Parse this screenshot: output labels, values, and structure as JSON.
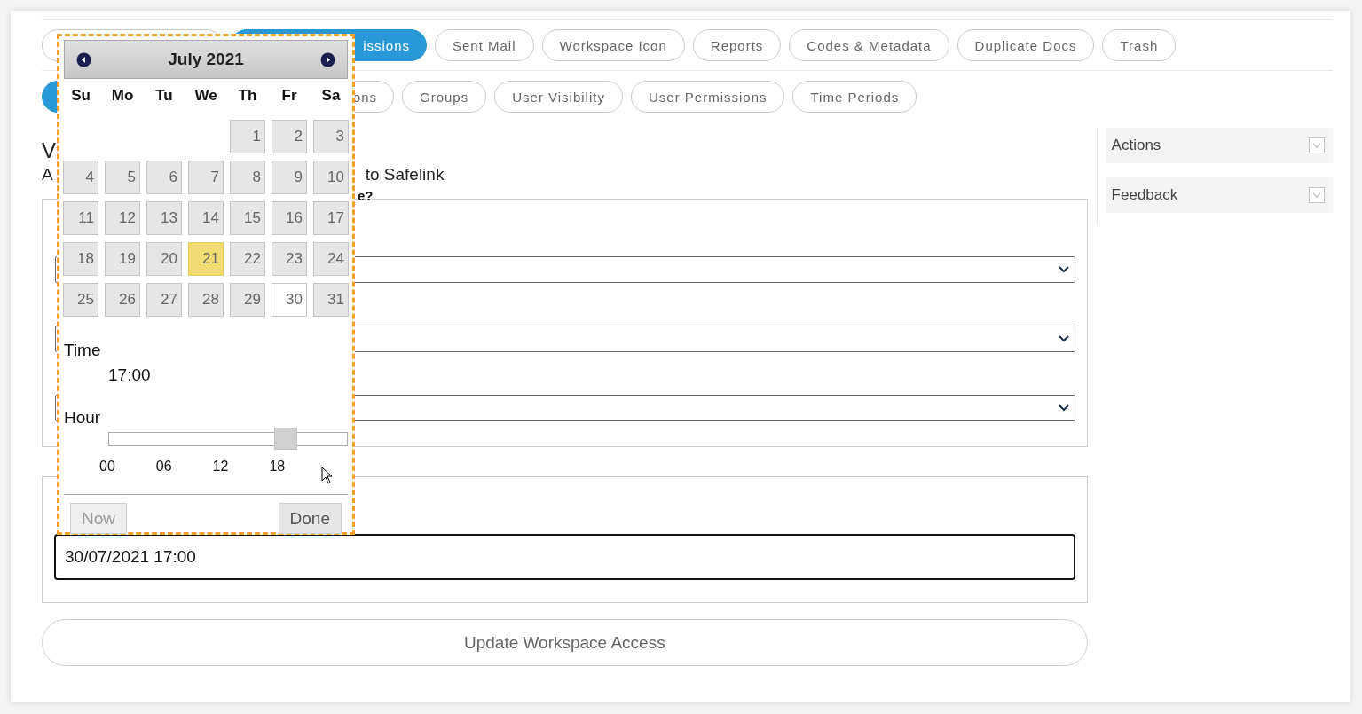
{
  "tab_rows": [
    {
      "tabs": [
        {
          "kind": "hidden",
          "selected": false
        },
        {
          "kind": "partial",
          "label": "issions",
          "selected": true
        },
        {
          "kind": "full",
          "label": "Sent Mail",
          "selected": false
        },
        {
          "kind": "full",
          "label": "Workspace Icon",
          "selected": false
        },
        {
          "kind": "full",
          "label": "Reports",
          "selected": false
        },
        {
          "kind": "full",
          "label": "Codes & Metadata",
          "selected": false
        },
        {
          "kind": "full",
          "label": "Duplicate Docs",
          "selected": false
        },
        {
          "kind": "full",
          "label": "Trash",
          "selected": false
        }
      ]
    },
    {
      "tabs": [
        {
          "kind": "stub",
          "selected": true
        },
        {
          "kind": "partial",
          "label": "ons",
          "selected": false
        },
        {
          "kind": "full",
          "label": "Groups",
          "selected": false
        },
        {
          "kind": "full",
          "label": "User Visibility",
          "selected": false
        },
        {
          "kind": "full",
          "label": "User Permissions",
          "selected": false
        },
        {
          "kind": "full",
          "label": "Time Periods",
          "selected": false
        }
      ]
    }
  ],
  "heading": {
    "visible_part": "V"
  },
  "description": {
    "start": "A",
    "end": "to Safelink"
  },
  "question": {
    "visible_part": "e?"
  },
  "access_panel": {
    "fields": [
      {
        "kind": "select"
      },
      {
        "kind": "select"
      },
      {
        "kind": "select"
      }
    ]
  },
  "date_panel": {
    "value": "30/07/2021 17:00"
  },
  "update_button": "Update Workspace Access",
  "sidebar": {
    "items": [
      {
        "label": "Actions",
        "expanded": false
      },
      {
        "label": "Feedback",
        "expanded": false
      }
    ]
  },
  "datepicker": {
    "month": "July 2021",
    "weekdays": [
      "Su",
      "Mo",
      "Tu",
      "We",
      "Th",
      "Fr",
      "Sa"
    ],
    "weeks": [
      [
        {
          "kind": "blank"
        },
        {
          "kind": "blank"
        },
        {
          "kind": "blank"
        },
        {
          "kind": "blank"
        },
        {
          "day": "1",
          "today": false,
          "selected": false
        },
        {
          "day": "2",
          "today": false,
          "selected": false
        },
        {
          "day": "3",
          "today": false,
          "selected": false
        }
      ],
      [
        {
          "day": "4",
          "today": false,
          "selected": false
        },
        {
          "day": "5",
          "today": false,
          "selected": false
        },
        {
          "day": "6",
          "today": false,
          "selected": false
        },
        {
          "day": "7",
          "today": false,
          "selected": false
        },
        {
          "day": "8",
          "today": false,
          "selected": false
        },
        {
          "day": "9",
          "today": false,
          "selected": false
        },
        {
          "day": "10",
          "today": false,
          "selected": false
        }
      ],
      [
        {
          "day": "11",
          "today": false,
          "selected": false
        },
        {
          "day": "12",
          "today": false,
          "selected": false
        },
        {
          "day": "13",
          "today": false,
          "selected": false
        },
        {
          "day": "14",
          "today": false,
          "selected": false
        },
        {
          "day": "15",
          "today": false,
          "selected": false
        },
        {
          "day": "16",
          "today": false,
          "selected": false
        },
        {
          "day": "17",
          "today": false,
          "selected": false
        }
      ],
      [
        {
          "day": "18",
          "today": false,
          "selected": false
        },
        {
          "day": "19",
          "today": false,
          "selected": false
        },
        {
          "day": "20",
          "today": false,
          "selected": false
        },
        {
          "day": "21",
          "today": true,
          "selected": false
        },
        {
          "day": "22",
          "today": false,
          "selected": false
        },
        {
          "day": "23",
          "today": false,
          "selected": false
        },
        {
          "day": "24",
          "today": false,
          "selected": false
        }
      ],
      [
        {
          "day": "25",
          "today": false,
          "selected": false
        },
        {
          "day": "26",
          "today": false,
          "selected": false
        },
        {
          "day": "27",
          "today": false,
          "selected": false
        },
        {
          "day": "28",
          "today": false,
          "selected": false
        },
        {
          "day": "29",
          "today": false,
          "selected": false
        },
        {
          "day": "30",
          "today": false,
          "selected": true
        },
        {
          "day": "31",
          "today": false,
          "selected": false
        }
      ]
    ],
    "time_label": "Time",
    "time_value": "17:00",
    "hour_label": "Hour",
    "hour_slider": {
      "level": 0.74
    },
    "hour_ticks": [
      "00",
      "06",
      "12",
      "18"
    ],
    "buttons": [
      {
        "label": "Now",
        "disabled": true
      },
      {
        "label": "Done",
        "disabled": false
      }
    ]
  }
}
